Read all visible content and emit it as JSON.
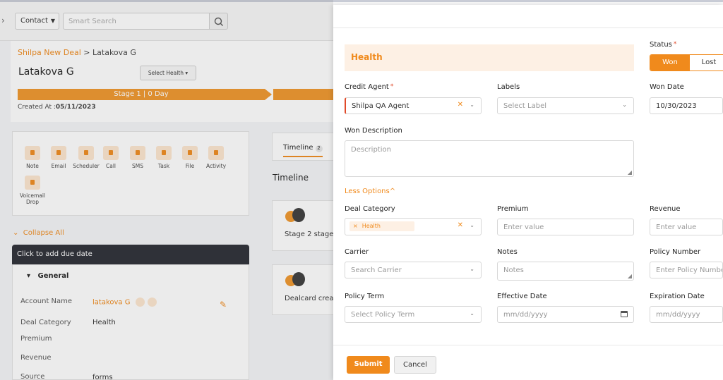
{
  "topbar": {
    "contact_label": "Contact",
    "search_placeholder": "Smart Search"
  },
  "deal": {
    "breadcrumb_link": "Shilpa New Deal",
    "breadcrumb_sep": " > ",
    "breadcrumb_current": "Latakova G",
    "name": "Latakova G",
    "select_health_label": "Select Health",
    "stage_label": "Stage 1 | 0 Day",
    "created_label": "Created At :",
    "created_value": "05/11/2023"
  },
  "actions": {
    "items": [
      "Note",
      "Email",
      "Scheduler",
      "Call",
      "SMS",
      "Task",
      "File",
      "Activity"
    ],
    "voicemail_line1": "Voicemail",
    "voicemail_line2": "Drop"
  },
  "collapse_all_label": "Collapse All",
  "due_date_label": "Click to add due date",
  "general": {
    "heading": "General",
    "rows": [
      {
        "label": "Account Name",
        "value": "latakova G"
      },
      {
        "label": "Deal Category",
        "value": "Health"
      },
      {
        "label": "Premium",
        "value": ""
      },
      {
        "label": "Revenue",
        "value": ""
      },
      {
        "label": "Source",
        "value": "forms"
      }
    ]
  },
  "timeline": {
    "tab_label": "Timeline",
    "tab_count": "2",
    "heading": "Timeline",
    "cards": [
      "Stage 2 stage",
      "Dealcard creat"
    ]
  },
  "form": {
    "banner": "Health",
    "status_label": "Status",
    "status_options": [
      "Won",
      "Lost"
    ],
    "status_selected": "Won",
    "credit_agent_label": "Credit Agent",
    "credit_agent_value": "Shilpa QA Agent",
    "labels_label": "Labels",
    "labels_placeholder": "Select Label",
    "won_date_label": "Won Date",
    "won_date_value": "10/30/2023",
    "won_desc_label": "Won Description",
    "won_desc_placeholder": "Description",
    "less_options_label": "Less Options",
    "deal_category_label": "Deal Category",
    "deal_category_tag": "Health",
    "premium_label": "Premium",
    "premium_placeholder": "Enter value",
    "revenue_label": "Revenue",
    "revenue_placeholder": "Enter value",
    "carrier_label": "Carrier",
    "carrier_placeholder": "Search Carrier",
    "notes_label": "Notes",
    "notes_placeholder": "Notes",
    "policy_number_label": "Policy Number",
    "policy_number_placeholder": "Enter Policy Number",
    "policy_term_label": "Policy Term",
    "policy_term_placeholder": "Select Policy Term",
    "effective_date_label": "Effective Date",
    "effective_date_placeholder": "mm/dd/yyyy",
    "expiration_date_label": "Expiration Date",
    "expiration_date_placeholder": "mm/dd/yyyy",
    "submit_label": "Submit",
    "cancel_label": "Cancel"
  },
  "colors": {
    "accent": "#f08a1c",
    "banner_bg": "#fdf0e4",
    "required": "#e04a2a"
  }
}
